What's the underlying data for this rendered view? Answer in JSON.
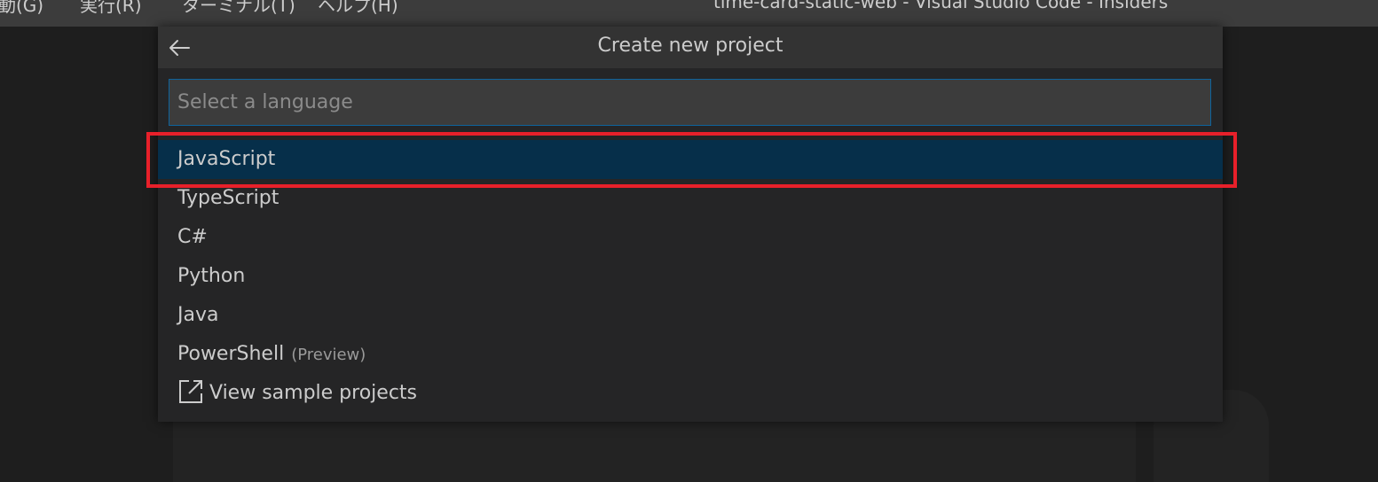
{
  "titlebar": {
    "menu": [
      "動(G)",
      "実行(R)",
      "ターミナル(T)",
      "ヘルプ(H)"
    ],
    "window_title": "time-card-static-web - Visual Studio Code - Insiders"
  },
  "quick_pick": {
    "title": "Create new project",
    "back_icon": "arrow-left-icon",
    "input_placeholder": "Select a language",
    "input_value": "",
    "items": [
      {
        "label": "JavaScript",
        "selected": true
      },
      {
        "label": "TypeScript"
      },
      {
        "label": "C#"
      },
      {
        "label": "Python"
      },
      {
        "label": "Java"
      },
      {
        "label": "PowerShell",
        "description": "(Preview)"
      },
      {
        "label": "View sample projects",
        "icon": "external-link-icon"
      }
    ]
  },
  "colors": {
    "selected_bg": "#062f4a",
    "highlight_border": "#e8202a",
    "focus_border": "#0e639c"
  }
}
